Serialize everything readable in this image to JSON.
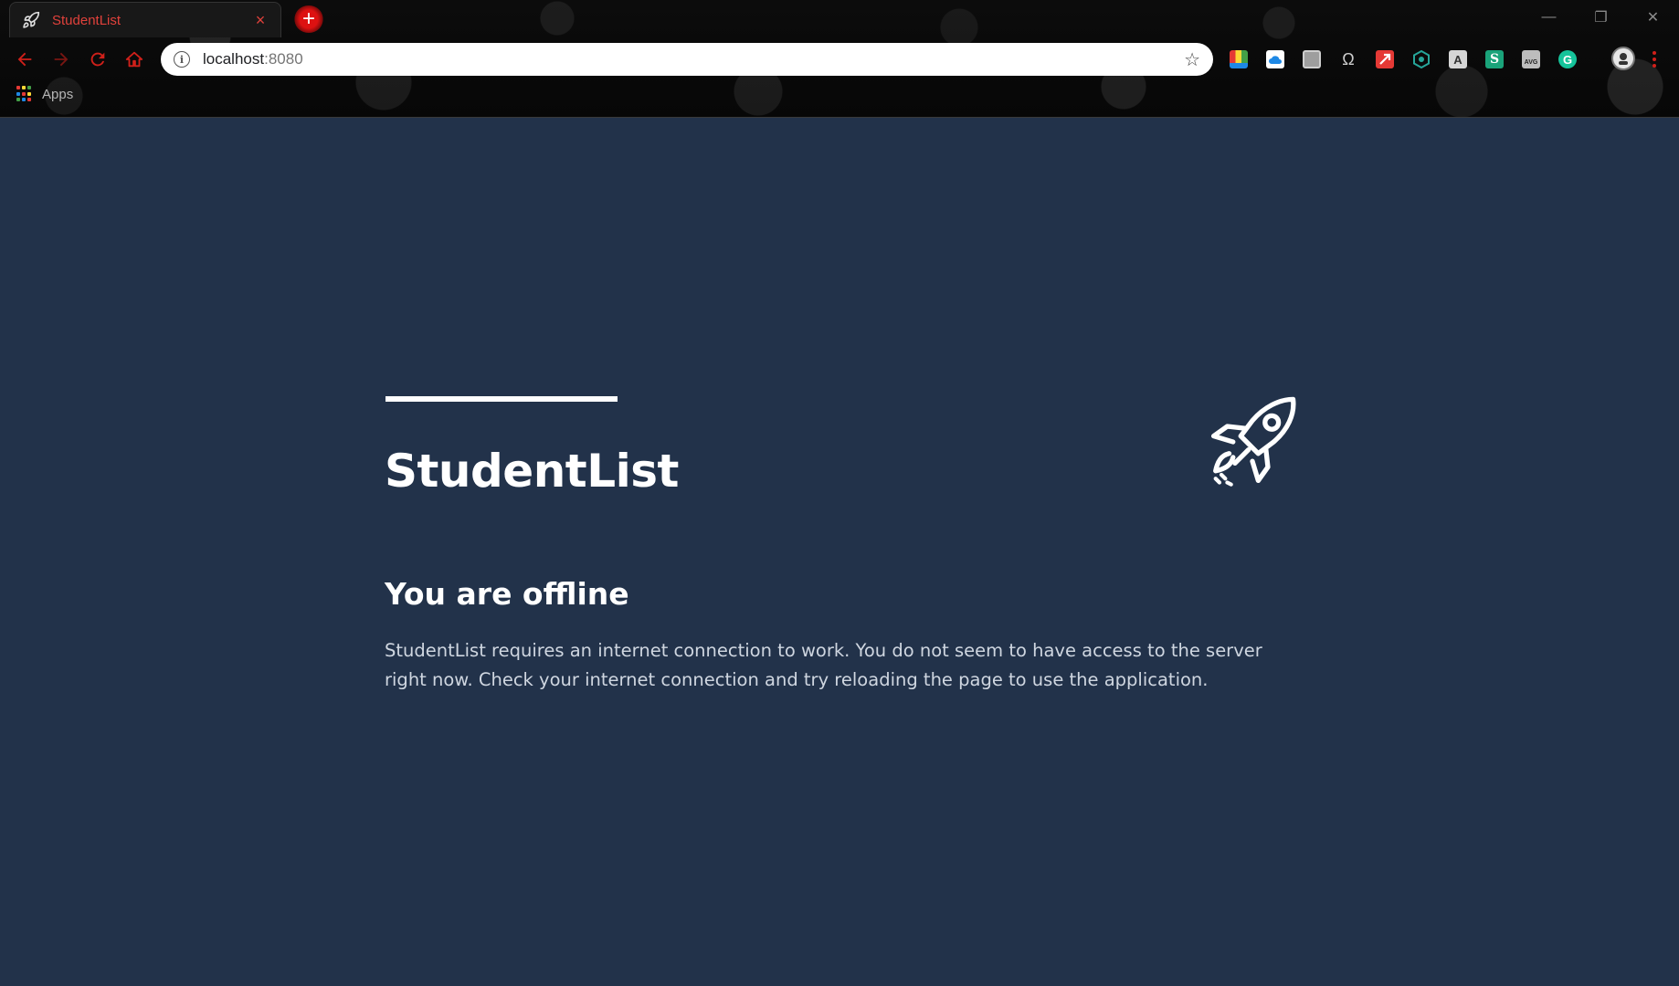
{
  "browser": {
    "tab": {
      "title": "StudentList",
      "close_glyph": "×",
      "favicon": "rocket-icon"
    },
    "new_tab_glyph": "+",
    "window_controls": {
      "minimize": "—",
      "restore": "❐",
      "close": "✕"
    },
    "omnibox": {
      "host": "localhost",
      "port": ":8080",
      "info_glyph": "i",
      "star_glyph": "☆"
    },
    "bookmarks": {
      "apps_label": "Apps"
    },
    "accent_color": "#d0201a",
    "extensions": [
      {
        "name": "color-palette-extension-icon",
        "color": "#e8c400"
      },
      {
        "name": "cloud-extension-icon",
        "color": "#1e88e5"
      },
      {
        "name": "box-extension-icon",
        "color": "#9e9e9e"
      },
      {
        "name": "omega-extension-icon",
        "color": "#cccccc"
      },
      {
        "name": "arrow-extension-icon",
        "color": "#e53935"
      },
      {
        "name": "hexagon-extension-icon",
        "color": "#26a69a"
      },
      {
        "name": "text-extension-icon",
        "color": "#d6d6d6"
      },
      {
        "name": "s-extension-icon",
        "color": "#1aa37a"
      },
      {
        "name": "avg-extension-icon",
        "color": "#bdbdbd"
      },
      {
        "name": "grammarly-extension-icon",
        "color": "#15c39a"
      }
    ]
  },
  "page": {
    "background_color": "#22324a",
    "title": "StudentList",
    "heading": "You are offline",
    "message": "StudentList requires an internet connection to work. You do not seem to have access to the server right now. Check your internet connection and try reloading the page to use the application."
  }
}
